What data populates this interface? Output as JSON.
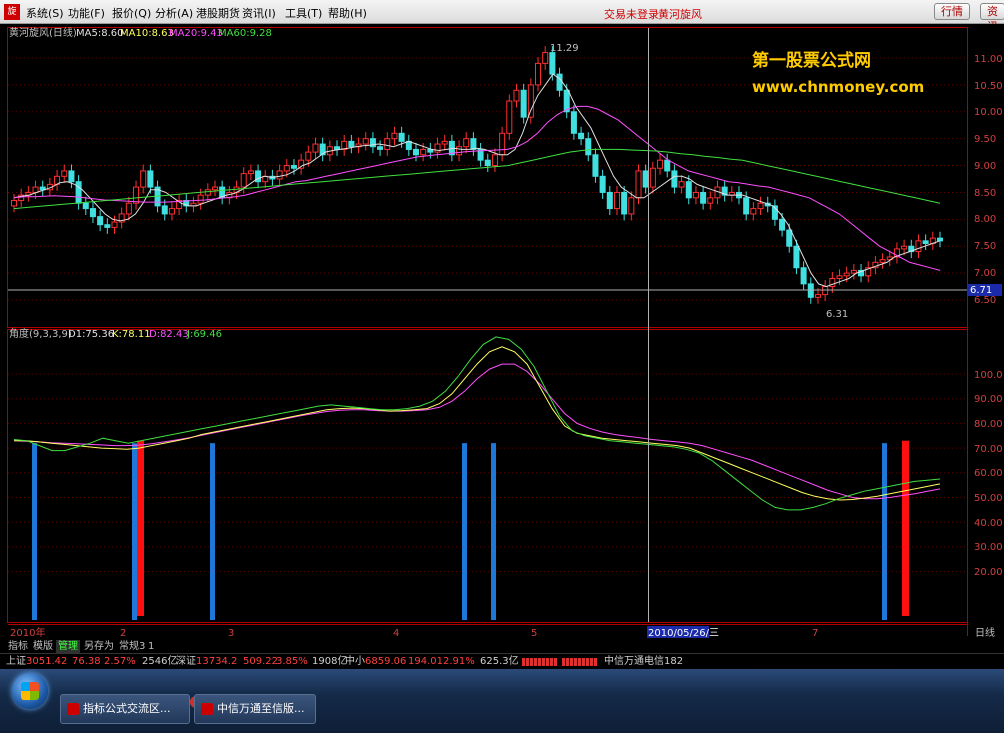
{
  "menubar": {
    "items": [
      "系统(S)",
      "功能(F)",
      "报价(Q)",
      "分析(A)",
      "港股期货",
      "资讯(I)",
      "工具(T)",
      "帮助(H)"
    ],
    "status_text": "交易未登录",
    "stock_name": "黄河旋风",
    "buttons": [
      "行情",
      "资讯"
    ]
  },
  "price_panel": {
    "legend": {
      "title": "黄河旋风(日线)",
      "ma5": "MA5:8.60",
      "ma10": "MA10:8.63",
      "ma20": "MA20:9.43",
      "ma60": "MA60:9.28"
    },
    "watermark_line1": "第一股票公式网",
    "watermark_line2": "www.chnmoney.com",
    "high_label": "11.29",
    "low_label": "6.31",
    "current_price_tag": "6.71",
    "yaxis_ticks": [
      "11.00",
      "10.50",
      "10.00",
      "9.50",
      "9.00",
      "8.50",
      "8.00",
      "7.50",
      "7.00",
      "6.50"
    ]
  },
  "indicator_panel": {
    "legend": {
      "title": "角度(9,3,3,9)",
      "d1": "D1:75.36",
      "k": "K:78.11",
      "d": "D:82.43",
      "j": "J:69.46"
    },
    "yaxis_ticks": [
      "100.0",
      "90.00",
      "80.00",
      "70.00",
      "60.00",
      "50.00",
      "40.00",
      "30.00",
      "20.00"
    ]
  },
  "xaxis": {
    "labels": [
      "2010年",
      "2",
      "3",
      "4",
      "5",
      "7"
    ],
    "cursor_date": "2010/05/26/三",
    "period": "日线"
  },
  "tabs": [
    "指标",
    "模版",
    "管理",
    "另存为",
    "常规3",
    "1"
  ],
  "indices": {
    "sh_label": "上证",
    "sh_value": "3051.42",
    "sh_change": "76.38",
    "sh_pct": "2.57%",
    "sh_amount": "2546亿",
    "sz_label": "深证",
    "sz_value": "13734.2",
    "sz_change": "509.22",
    "sz_pct": "3.85%",
    "sz_amount": "1908亿",
    "zx_label": "中小",
    "zx_value": "6859.06",
    "zx_change": "194.01",
    "zx_pct": "2.91%",
    "zx_amount": "625.3亿",
    "broker": "中信万通电信182"
  },
  "taskbar": {
    "tasks": [
      "指标公式交流区...",
      "中信万通至信版..."
    ]
  },
  "chart_data": {
    "type": "candlestick",
    "price_close": [
      8.35,
      8.45,
      8.5,
      8.6,
      8.55,
      8.65,
      8.8,
      8.9,
      8.7,
      8.3,
      8.2,
      8.05,
      7.9,
      7.85,
      7.95,
      8.1,
      8.3,
      8.6,
      8.9,
      8.6,
      8.25,
      8.1,
      8.2,
      8.35,
      8.25,
      8.3,
      8.45,
      8.55,
      8.6,
      8.4,
      8.5,
      8.6,
      8.85,
      8.9,
      8.7,
      8.8,
      8.75,
      8.9,
      9.0,
      8.95,
      9.1,
      9.25,
      9.4,
      9.2,
      9.35,
      9.3,
      9.45,
      9.35,
      9.4,
      9.5,
      9.35,
      9.3,
      9.5,
      9.6,
      9.45,
      9.3,
      9.2,
      9.3,
      9.25,
      9.4,
      9.45,
      9.2,
      9.35,
      9.5,
      9.3,
      9.1,
      9.0,
      9.2,
      9.6,
      10.2,
      10.4,
      9.9,
      10.5,
      10.9,
      11.1,
      10.7,
      10.4,
      10.0,
      9.6,
      9.5,
      9.2,
      8.8,
      8.5,
      8.2,
      8.5,
      8.1,
      8.4,
      8.9,
      8.6,
      8.95,
      9.1,
      8.9,
      8.6,
      8.7,
      8.4,
      8.5,
      8.3,
      8.4,
      8.6,
      8.45,
      8.5,
      8.4,
      8.1,
      8.2,
      8.3,
      8.25,
      8.0,
      7.8,
      7.5,
      7.1,
      6.8,
      6.55,
      6.6,
      6.75,
      6.9,
      6.95,
      7.0,
      7.05,
      6.95,
      7.1,
      7.2,
      7.25,
      7.3,
      7.45,
      7.5,
      7.4,
      7.6,
      7.55,
      7.65,
      7.6
    ],
    "ma5": [
      8.4,
      8.43,
      8.45,
      8.5,
      8.55,
      8.6,
      8.68,
      8.7,
      8.65,
      8.55,
      8.4,
      8.25,
      8.1,
      8.0,
      7.97,
      8.0,
      8.1,
      8.3,
      8.55,
      8.55,
      8.5,
      8.4,
      8.3,
      8.25,
      8.25,
      8.3,
      8.35,
      8.4,
      8.45,
      8.48,
      8.55,
      8.65,
      8.75,
      8.8,
      8.78,
      8.8,
      8.83,
      8.9,
      9.0,
      9.05,
      9.15,
      9.25,
      9.28,
      9.3,
      9.32,
      9.35,
      9.37,
      9.38,
      9.4,
      9.38,
      9.35,
      9.4,
      9.45,
      9.4,
      9.35,
      9.3,
      9.28,
      9.3,
      9.32,
      9.3,
      9.3,
      9.32,
      9.3,
      9.25,
      9.2,
      9.2,
      9.3,
      9.6,
      10.0,
      10.3,
      10.5,
      10.7,
      10.6,
      10.4,
      10.1,
      9.9,
      9.7,
      9.4,
      9.1,
      8.8,
      8.6,
      8.5,
      8.4,
      8.4,
      8.5,
      8.6,
      8.7,
      8.8,
      8.8,
      8.75,
      8.65,
      8.6,
      8.55,
      8.5,
      8.45,
      8.45,
      8.45,
      8.4,
      8.35,
      8.3,
      8.25,
      8.1,
      7.9,
      7.6,
      7.3,
      7.0,
      6.8,
      6.75,
      6.8,
      6.85,
      6.9,
      7.0,
      7.05,
      7.1,
      7.15,
      7.2,
      7.3,
      7.35,
      7.4,
      7.45,
      7.5,
      7.55,
      7.6
    ],
    "ma20": [
      8.4,
      8.42,
      8.42,
      8.43,
      8.44,
      8.43,
      8.42,
      8.4,
      8.38,
      8.36,
      8.35,
      8.34,
      8.33,
      8.32,
      8.32,
      8.32,
      8.33,
      8.34,
      8.35,
      8.36,
      8.38,
      8.4,
      8.42,
      8.45,
      8.5,
      8.55,
      8.6,
      8.65,
      8.7,
      8.72,
      8.76,
      8.8,
      8.84,
      8.88,
      8.92,
      8.96,
      9.0,
      9.04,
      9.08,
      9.12,
      9.16,
      9.18,
      9.2,
      9.22,
      9.24,
      9.26,
      9.27,
      9.28,
      9.29,
      9.3,
      9.35,
      9.45,
      9.6,
      9.8,
      9.95,
      10.05,
      10.1,
      10.1,
      10.05,
      9.95,
      9.85,
      9.7,
      9.55,
      9.4,
      9.25,
      9.1,
      9.0,
      8.9,
      8.85,
      8.8,
      8.75,
      8.7,
      8.68,
      8.65,
      8.62,
      8.6,
      8.55,
      8.5,
      8.45,
      8.4,
      8.3,
      8.2,
      8.1,
      7.95,
      7.8,
      7.65,
      7.5,
      7.4,
      7.3,
      7.2,
      7.15,
      7.1,
      7.05
    ],
    "ma60": [
      8.2,
      8.22,
      8.24,
      8.26,
      8.28,
      8.3,
      8.32,
      8.34,
      8.36,
      8.38,
      8.4,
      8.42,
      8.44,
      8.46,
      8.48,
      8.5,
      8.52,
      8.54,
      8.56,
      8.58,
      8.6,
      8.62,
      8.64,
      8.66,
      8.68,
      8.7,
      8.72,
      8.74,
      8.76,
      8.78,
      8.8,
      8.82,
      8.84,
      8.86,
      8.88,
      8.9,
      8.92,
      8.94,
      8.96,
      8.98,
      9.0,
      9.05,
      9.1,
      9.15,
      9.2,
      9.25,
      9.28,
      9.3,
      9.3,
      9.3,
      9.29,
      9.28,
      9.27,
      9.25,
      9.22,
      9.2,
      9.17,
      9.15,
      9.12,
      9.1,
      9.05,
      9.0,
      8.95,
      8.9,
      8.85,
      8.8,
      8.75,
      8.7,
      8.65,
      8.6,
      8.55,
      8.5,
      8.45,
      8.4,
      8.35,
      8.3
    ],
    "indicator_k": [
      73,
      73,
      72.5,
      72,
      71.5,
      71,
      70.5,
      70,
      69.8,
      69.5,
      70,
      71,
      72,
      73,
      74,
      75.5,
      76.5,
      77.5,
      78.5,
      79.5,
      80.5,
      81.5,
      82.5,
      83.5,
      84.5,
      85.5,
      86,
      86.2,
      86,
      85.5,
      85,
      85.2,
      85.5,
      86,
      88,
      92,
      98,
      104,
      109,
      111,
      109,
      104,
      95,
      86,
      79,
      76,
      75,
      74,
      73.5,
      73,
      72.5,
      72,
      71.5,
      71,
      70,
      68,
      66,
      64,
      62,
      60,
      58,
      56,
      54,
      52,
      50.5,
      49.5,
      49,
      49.2,
      49.8,
      50.5,
      51.5,
      52.5,
      53.5,
      54.5,
      55.5
    ],
    "indicator_j": [
      73.5,
      73,
      71,
      69,
      69,
      70.5,
      72,
      74,
      73,
      72,
      73,
      74,
      75,
      76,
      77,
      78,
      79,
      80,
      81,
      82,
      83,
      84,
      85,
      86,
      87,
      87.5,
      87,
      86.5,
      86,
      85.5,
      85.5,
      86,
      87,
      89,
      93,
      99,
      106,
      112,
      115,
      114,
      110,
      103,
      93,
      83,
      77,
      75,
      74,
      73,
      72.5,
      72,
      71.5,
      71,
      70.5,
      69.5,
      68,
      65,
      61,
      57,
      53,
      49,
      46,
      45,
      45,
      46,
      47.5,
      49.5,
      51,
      52.5,
      53.5,
      54.5,
      55.5,
      56.5,
      57,
      57.5
    ],
    "indicator_d": [
      73,
      72.8,
      72.5,
      72.2,
      72,
      71.8,
      71.5,
      71.3,
      71,
      71,
      71.2,
      71.8,
      72.5,
      73.3,
      74.2,
      75.2,
      76.2,
      77.2,
      78.2,
      79.2,
      80.2,
      81.2,
      82.2,
      83.2,
      84,
      84.8,
      85.3,
      85.5,
      85.5,
      85.2,
      85,
      85,
      85.2,
      85.5,
      86.5,
      89,
      93,
      98,
      102,
      104,
      104,
      101,
      96,
      90,
      84,
      80,
      78,
      76.5,
      75.5,
      74.8,
      74.2,
      73.5,
      73,
      72.5,
      72,
      71,
      69.5,
      68,
      66.5,
      65,
      63,
      61,
      59,
      57,
      55,
      53,
      51.5,
      50,
      49.5,
      49.5,
      50,
      50.8,
      51.5,
      52.5,
      53.5
    ],
    "signals_blue": [
      "2010-01",
      "2010-02",
      "2010-03",
      "2010-04",
      "2010-05",
      "2010-07"
    ],
    "signals_red": [
      "2010-02",
      "2010-07"
    ]
  }
}
